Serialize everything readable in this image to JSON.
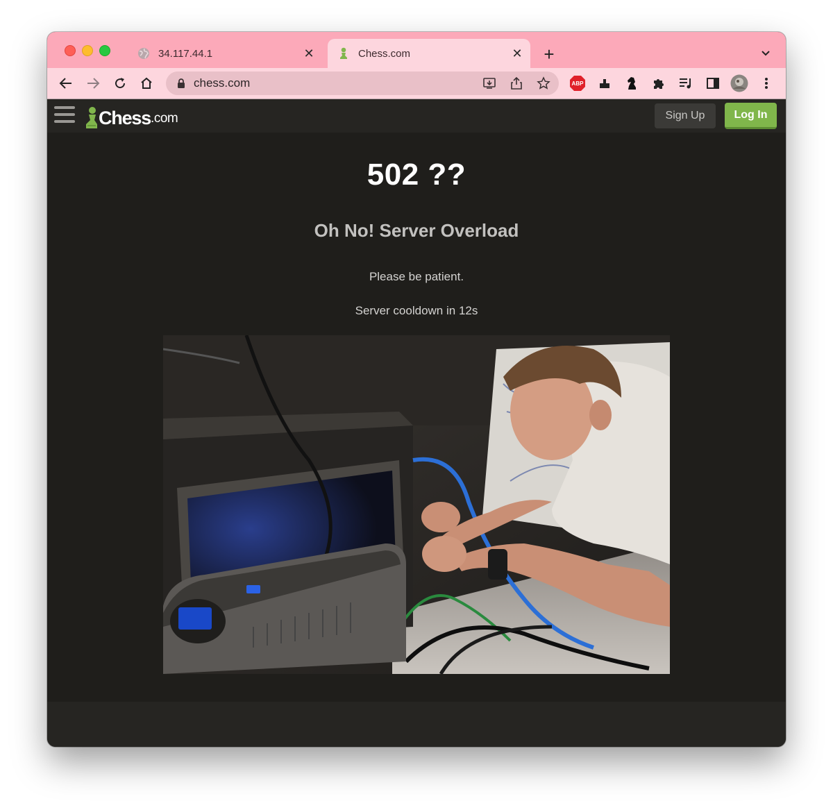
{
  "browser": {
    "tabs": [
      {
        "title": "34.117.44.1",
        "active": false,
        "favicon": "globe-icon"
      },
      {
        "title": "Chess.com",
        "active": true,
        "favicon": "chess-pawn-icon"
      }
    ],
    "address": "chess.com",
    "colors": {
      "tabstrip": "#fca9b9",
      "toolbar": "#fdd6de",
      "omnibox": "#e9c0c8"
    }
  },
  "site": {
    "logo_text": "Chess",
    "logo_suffix": ".com",
    "signup_label": "Sign Up",
    "login_label": "Log In",
    "colors": {
      "login": "#80b64b",
      "background": "#1f1e1b",
      "header": "#262522"
    }
  },
  "error": {
    "code": "502 ??",
    "headline": "Oh No! Server Overload",
    "message": "Please be patient.",
    "cooldown": "Server cooldown in 12s"
  }
}
